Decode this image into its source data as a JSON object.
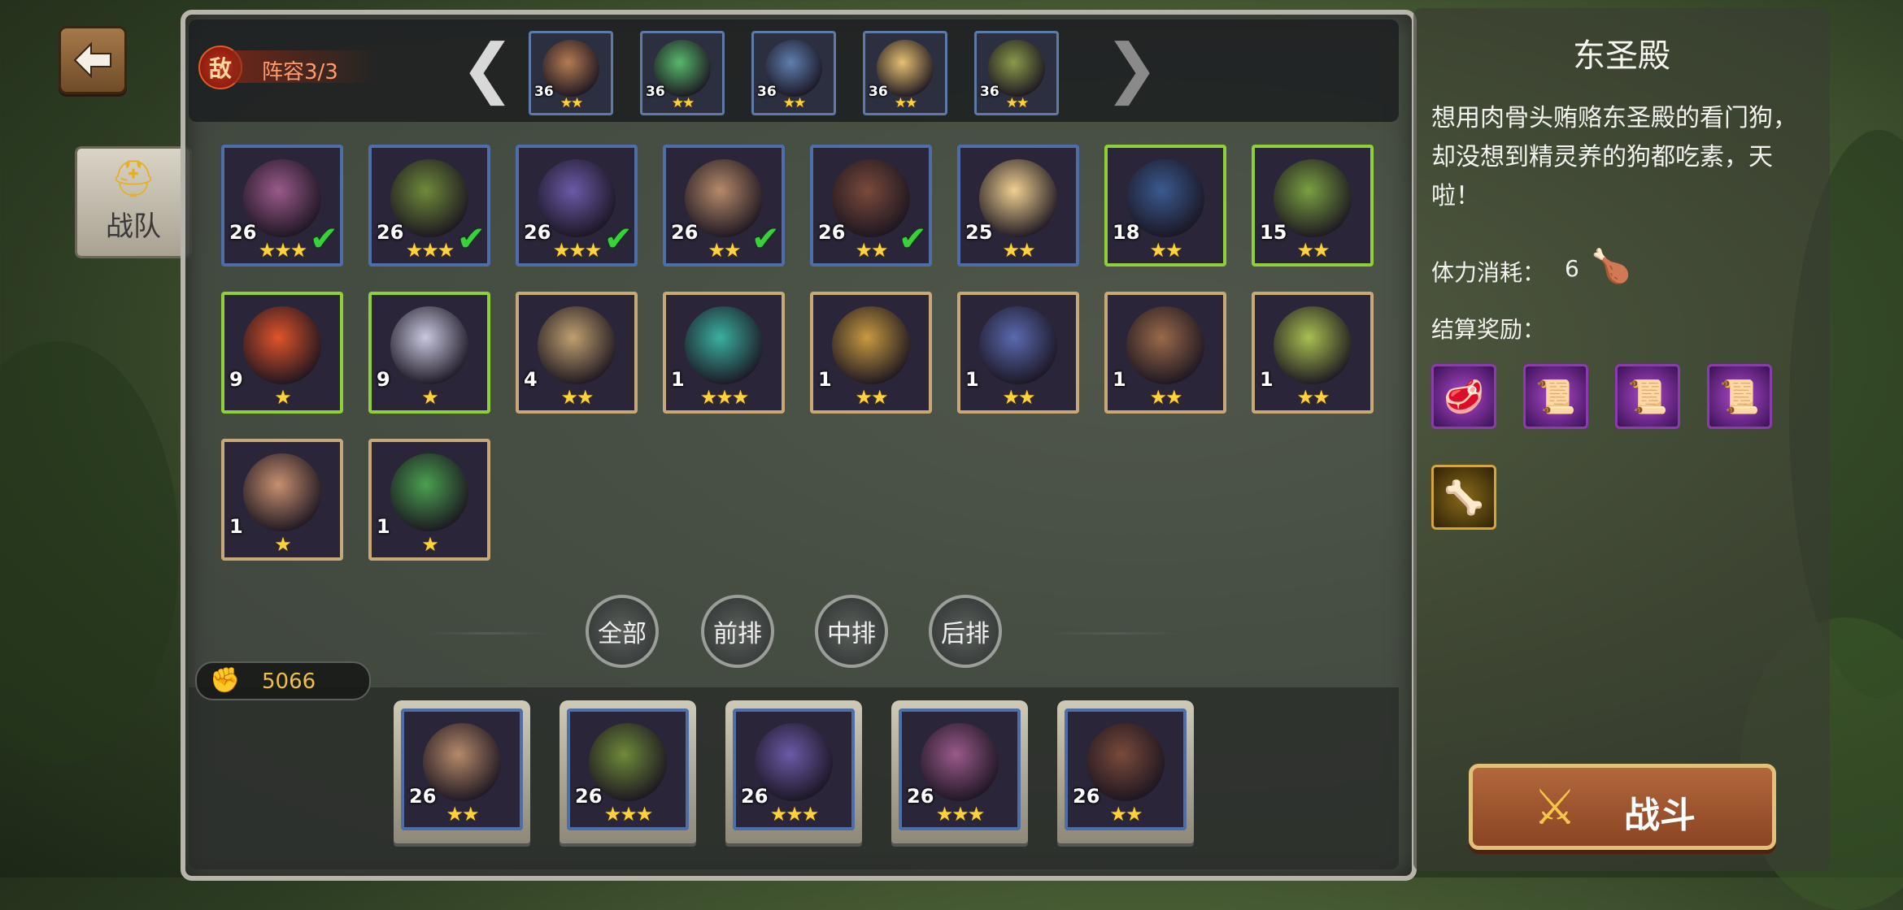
{
  "back_button": {
    "icon": "left-arrow-icon"
  },
  "side_tab": {
    "label": "战队",
    "icon": "helmet-icon"
  },
  "enemy": {
    "badge": "敌",
    "label": "阵容3/3",
    "prev_arrow": "❮",
    "next_arrow": "❯",
    "portraits": [
      {
        "level": "36",
        "stars": "★★",
        "color": "#b57b52"
      },
      {
        "level": "36",
        "stars": "★★",
        "color": "#58b86c"
      },
      {
        "level": "36",
        "stars": "★★",
        "color": "#5f7fb0"
      },
      {
        "level": "36",
        "stars": "★★",
        "color": "#e6c070"
      },
      {
        "level": "36",
        "stars": "★★",
        "color": "#8a9a4a"
      }
    ]
  },
  "heroes": [
    {
      "level": "26",
      "stars": "★★★",
      "checked": true,
      "frame": "blue",
      "color": "#9a5a8a"
    },
    {
      "level": "26",
      "stars": "★★★",
      "checked": true,
      "frame": "blue",
      "color": "#6f8a3a"
    },
    {
      "level": "26",
      "stars": "★★★",
      "checked": true,
      "frame": "blue",
      "color": "#6a5aa8"
    },
    {
      "level": "26",
      "stars": "★★",
      "checked": true,
      "frame": "blue",
      "color": "#b68a6a"
    },
    {
      "level": "26",
      "stars": "★★",
      "checked": true,
      "frame": "blue",
      "color": "#7a4a3a"
    },
    {
      "level": "25",
      "stars": "★★",
      "checked": false,
      "frame": "blue",
      "color": "#f0d090"
    },
    {
      "level": "18",
      "stars": "★★",
      "checked": false,
      "frame": "green",
      "color": "#3a5a90"
    },
    {
      "level": "15",
      "stars": "★★",
      "checked": false,
      "frame": "green",
      "color": "#7aa040"
    },
    {
      "level": "9",
      "stars": "★",
      "checked": false,
      "frame": "green",
      "color": "#e0542a"
    },
    {
      "level": "9",
      "stars": "★",
      "checked": false,
      "frame": "green",
      "color": "#c8c8e0"
    },
    {
      "level": "4",
      "stars": "★★",
      "checked": false,
      "frame": "gold",
      "color": "#c0a070"
    },
    {
      "level": "1",
      "stars": "★★★",
      "checked": false,
      "frame": "gold",
      "color": "#3ab0a0"
    },
    {
      "level": "1",
      "stars": "★★",
      "checked": false,
      "frame": "gold",
      "color": "#c89a40"
    },
    {
      "level": "1",
      "stars": "★★",
      "checked": false,
      "frame": "gold",
      "color": "#5a6ab0"
    },
    {
      "level": "1",
      "stars": "★★",
      "checked": false,
      "frame": "gold",
      "color": "#9a6a4a"
    },
    {
      "level": "1",
      "stars": "★★",
      "checked": false,
      "frame": "gold",
      "color": "#a8c050"
    },
    {
      "level": "1",
      "stars": "★",
      "checked": false,
      "frame": "gold",
      "color": "#c89070"
    },
    {
      "level": "1",
      "stars": "★",
      "checked": false,
      "frame": "gold",
      "color": "#4aa050"
    }
  ],
  "filters": [
    {
      "label": "全部",
      "active": true
    },
    {
      "label": "前排",
      "active": false
    },
    {
      "label": "中排",
      "active": false
    },
    {
      "label": "后排",
      "active": false
    }
  ],
  "power": {
    "value": "5066",
    "icon": "fist-icon"
  },
  "lineup": [
    {
      "level": "26",
      "stars": "★★",
      "color": "#b68a6a"
    },
    {
      "level": "26",
      "stars": "★★★",
      "color": "#6f8a3a"
    },
    {
      "level": "26",
      "stars": "★★★",
      "color": "#6a5aa8"
    },
    {
      "level": "26",
      "stars": "★★★",
      "color": "#9a5a8a"
    },
    {
      "level": "26",
      "stars": "★★",
      "color": "#7a4a3a"
    }
  ],
  "stage": {
    "title": "东圣殿",
    "description": "想用肉骨头贿赂东圣殿的看门狗，却没想到精灵养的狗都吃素，天啦！",
    "stamina_label": "体力消耗：",
    "stamina_value": "6",
    "stamina_icon": "drumstick-icon",
    "reward_label": "结算奖励：",
    "rewards": [
      {
        "icon": "meat-icon",
        "glyph": "🥩",
        "rarity": "epic"
      },
      {
        "icon": "scroll-icon",
        "glyph": "📜",
        "rarity": "epic"
      },
      {
        "icon": "scroll-icon",
        "glyph": "📜",
        "rarity": "epic"
      },
      {
        "icon": "scroll-icon",
        "glyph": "📜",
        "rarity": "epic"
      },
      {
        "icon": "bone-icon",
        "glyph": "🦴",
        "rarity": "legendary"
      }
    ]
  },
  "battle_button": {
    "label": "战斗",
    "icon": "crossed-swords-icon"
  }
}
